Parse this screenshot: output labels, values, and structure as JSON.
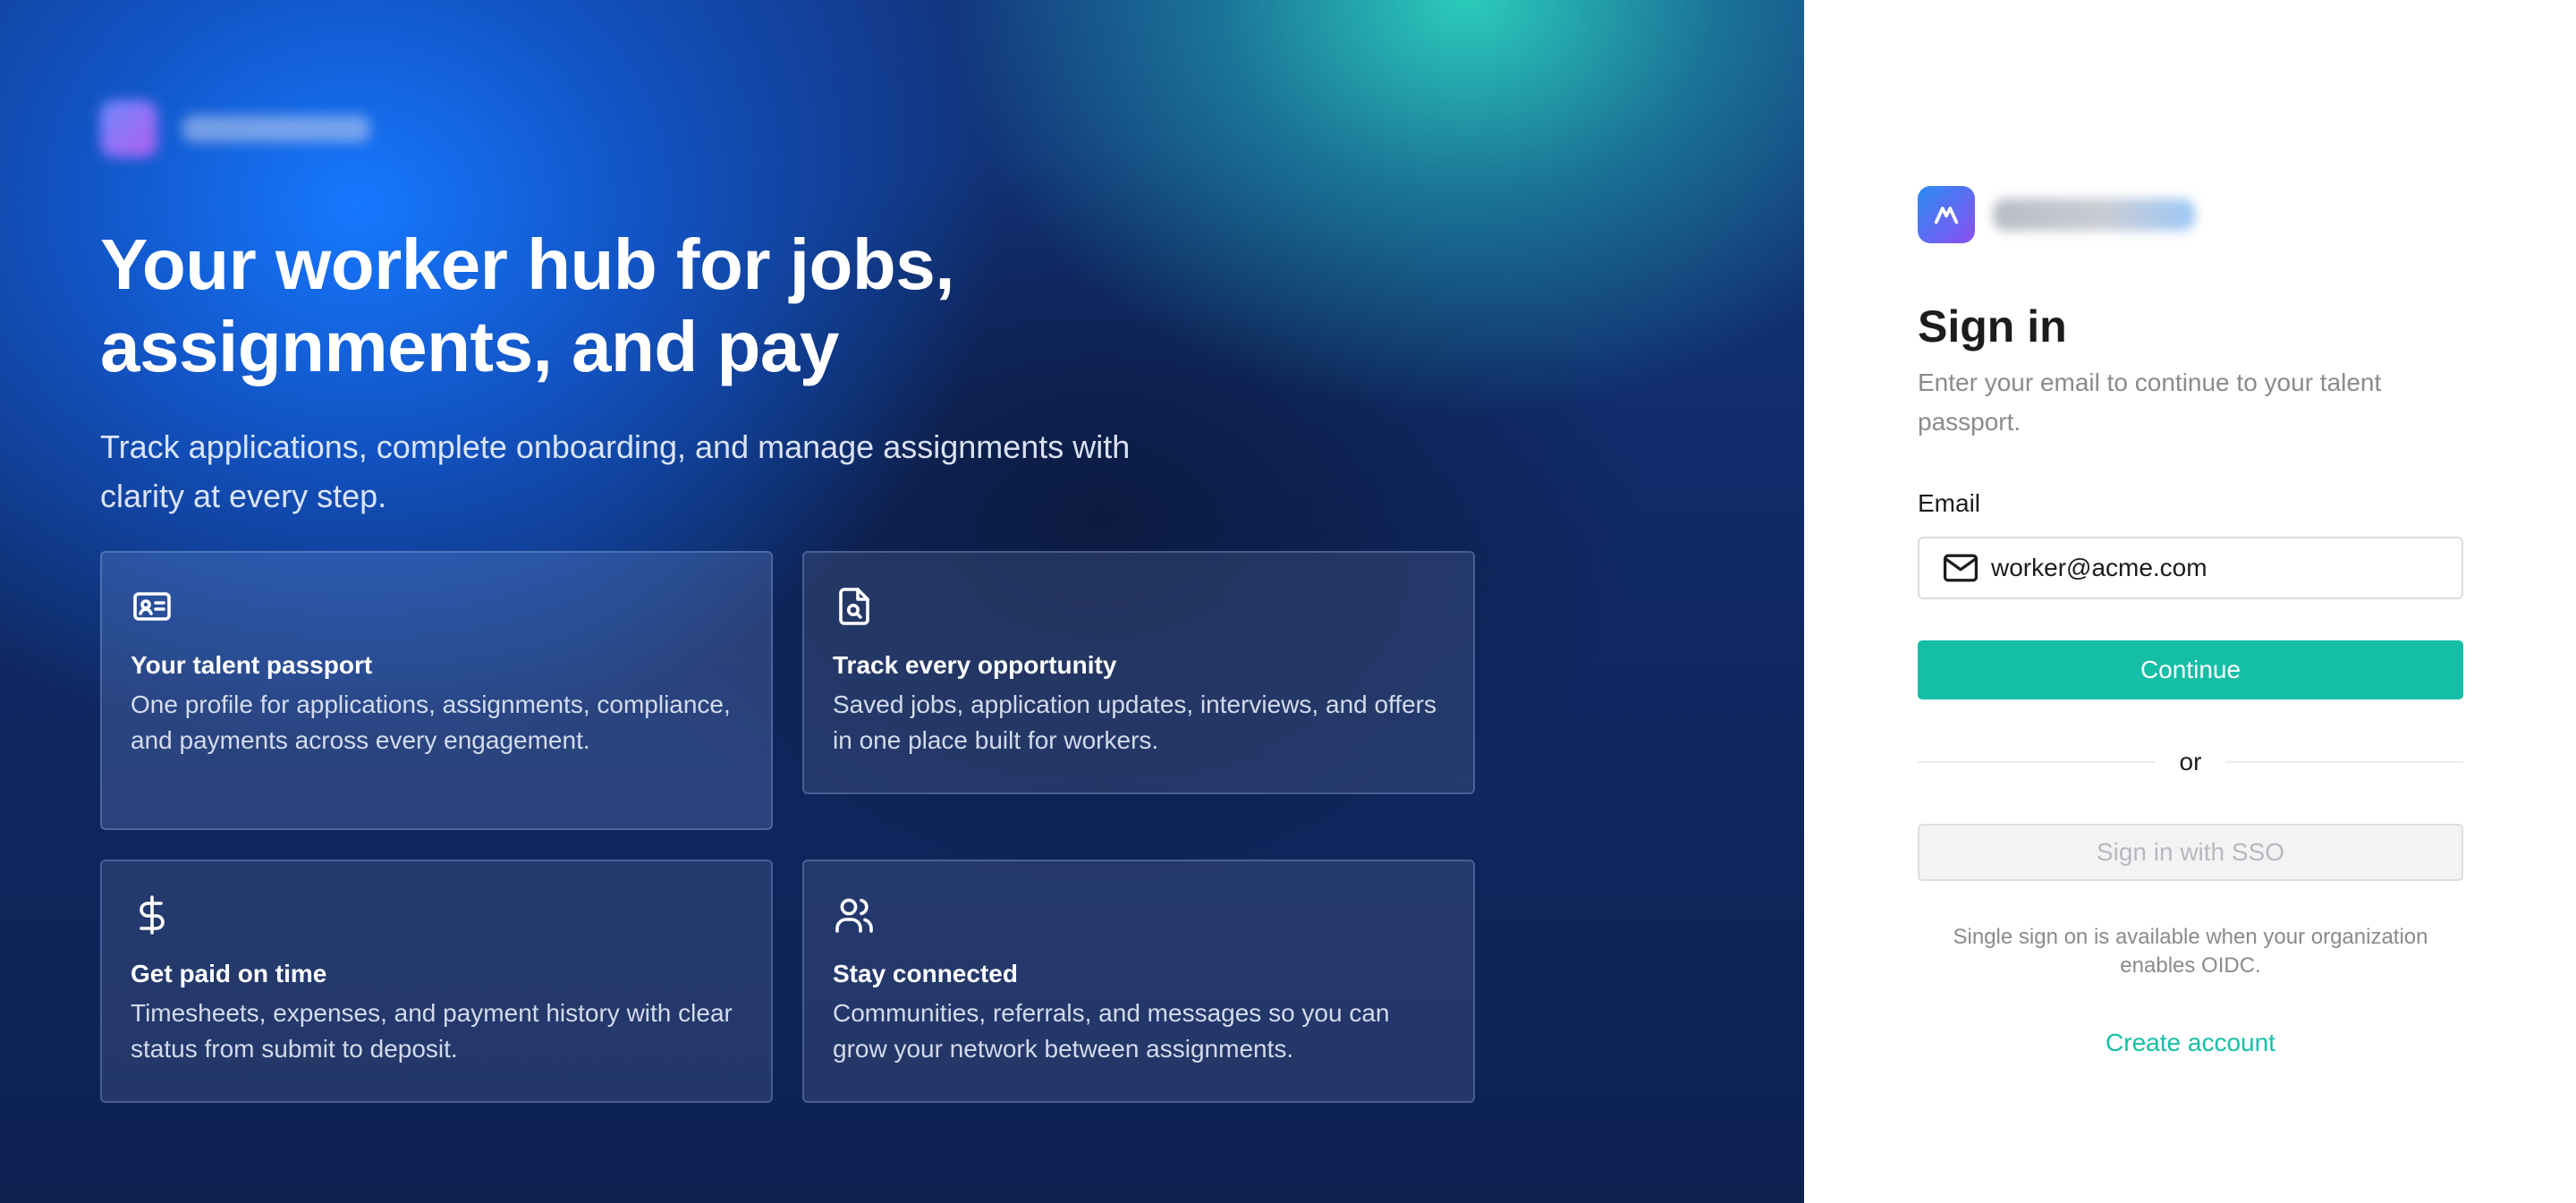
{
  "colors": {
    "accent": "#14bfa6",
    "hero_blue": "#1678ff",
    "hero_navy": "#0e2252",
    "hero_teal": "#2dd4bf",
    "text_dark": "#1c1c1e",
    "text_muted": "#8a8a8f"
  },
  "hero": {
    "headline": "Your worker hub for jobs, assignments, and pay",
    "subline": "Track applications, complete onboarding, and manage assignments with clarity at every step.",
    "features": [
      {
        "icon": "id-card-icon",
        "title": "Your talent passport",
        "description": "One profile for applications, assignments, compliance, and payments across every engagement."
      },
      {
        "icon": "file-search-icon",
        "title": "Track every opportunity",
        "description": "Saved jobs, application updates, interviews, and offers in one place built for workers."
      },
      {
        "icon": "dollar-sign-icon",
        "title": "Get paid on time",
        "description": "Timesheets, expenses, and payment history with clear status from submit to deposit."
      },
      {
        "icon": "users-icon",
        "title": "Stay connected",
        "description": "Communities, referrals, and messages so you can grow your network between assignments."
      }
    ]
  },
  "signin": {
    "title": "Sign in",
    "subtitle": "Enter your email to continue to your talent passport.",
    "email_label": "Email",
    "email_value": "worker@acme.com",
    "email_icon": "mail-icon",
    "continue_label": "Continue",
    "divider_text": "or",
    "sso_label": "Sign in with SSO",
    "sso_note": "Single sign on is available when your organization enables OIDC.",
    "create_account_label": "Create account"
  }
}
